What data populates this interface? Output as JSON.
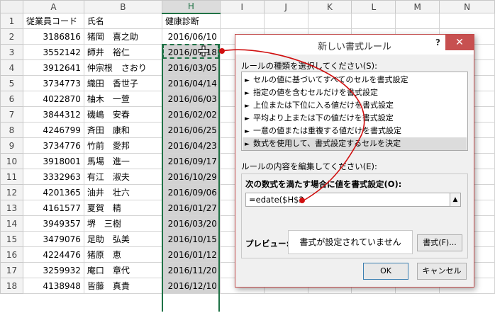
{
  "spreadsheet": {
    "columns": [
      "A",
      "B",
      "H",
      "I",
      "J",
      "K",
      "L",
      "M",
      "N"
    ],
    "header_row": {
      "row_number": "1",
      "a": "従業員コード",
      "b": "氏名",
      "h": "健康診断"
    },
    "rows": [
      {
        "n": "2",
        "code": "3186816",
        "name": "猪岡　喜之助",
        "date": "2016/06/10"
      },
      {
        "n": "3",
        "code": "3552142",
        "name": "師井　裕仁",
        "date": "2016/07/18"
      },
      {
        "n": "4",
        "code": "3912641",
        "name": "仲宗根　さおり",
        "date": "2016/03/05"
      },
      {
        "n": "5",
        "code": "3734773",
        "name": "織田　香世子",
        "date": "2016/04/14"
      },
      {
        "n": "6",
        "code": "4022870",
        "name": "柚木　一萱",
        "date": "2016/06/03"
      },
      {
        "n": "7",
        "code": "3844312",
        "name": "磯嶋　安春",
        "date": "2016/02/02"
      },
      {
        "n": "8",
        "code": "4246799",
        "name": "斉田　康和",
        "date": "2016/06/25"
      },
      {
        "n": "9",
        "code": "3734776",
        "name": "竹前　愛邦",
        "date": "2016/04/23"
      },
      {
        "n": "10",
        "code": "3918001",
        "name": "馬場　進一",
        "date": "2016/09/17"
      },
      {
        "n": "11",
        "code": "3332963",
        "name": "有江　淑夫",
        "date": "2016/10/29"
      },
      {
        "n": "12",
        "code": "4201365",
        "name": "油井　壮六",
        "date": "2016/09/06"
      },
      {
        "n": "13",
        "code": "4161577",
        "name": "夏賀　精",
        "date": "2016/01/27"
      },
      {
        "n": "14",
        "code": "3949357",
        "name": "堺　三樹",
        "date": "2016/03/20"
      },
      {
        "n": "15",
        "code": "3479076",
        "name": "足助　弘美",
        "date": "2016/10/15"
      },
      {
        "n": "16",
        "code": "4224476",
        "name": "猪原　恵",
        "date": "2016/01/12"
      },
      {
        "n": "17",
        "code": "3259932",
        "name": "庵口　章代",
        "date": "2016/11/20"
      },
      {
        "n": "18",
        "code": "4138948",
        "name": "皆藤　真貴",
        "date": "2016/12/10"
      }
    ]
  },
  "dialog": {
    "title": "新しい書式ルール",
    "help": "?",
    "close": "✕",
    "select_rule_type_label": "ルールの種類を選択してください(S):",
    "rule_types": [
      "セルの値に基づいてすべてのセルを書式設定",
      "指定の値を含むセルだけを書式設定",
      "上位または下位に入る値だけを書式設定",
      "平均より上または下の値だけを書式設定",
      "一意の値または重複する値だけを書式設定",
      "数式を使用して、書式設定するセルを決定"
    ],
    "selected_rule_index": 5,
    "edit_rule_label": "ルールの内容を編集してください(E):",
    "formula_label": "次の数式を満たす場合に値を書式設定(O):",
    "formula_value": "=edate($H$2",
    "preview_label": "プレビュー:",
    "preview_text": "書式が設定されていません",
    "format_button": "書式(F)...",
    "ok_button": "OK",
    "cancel_button": "キャンセル",
    "accent_color": "#c75050"
  },
  "annotation": {
    "arrow_color": "#d01010"
  }
}
